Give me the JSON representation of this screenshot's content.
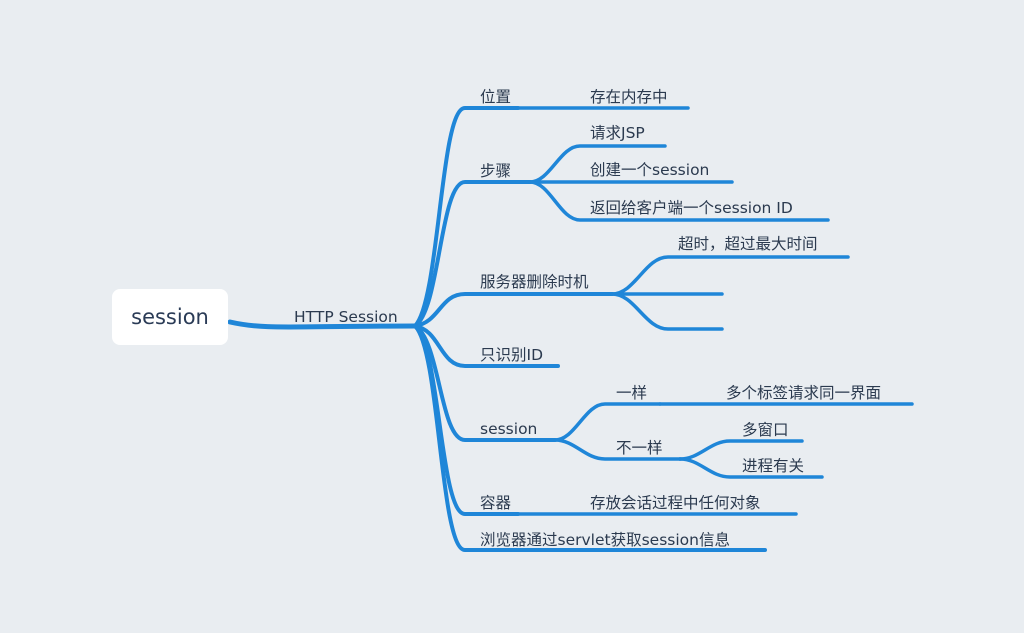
{
  "root": {
    "label": "session"
  },
  "main_branch": {
    "label": "HTTP Session"
  },
  "branches": [
    {
      "label": "位置",
      "children": [
        {
          "label": "存在内存中"
        }
      ]
    },
    {
      "label": "步骤",
      "children": [
        {
          "label": "请求JSP"
        },
        {
          "label": "创建一个session"
        },
        {
          "label": "返回给客户端一个session ID"
        }
      ]
    },
    {
      "label": "服务器删除时机",
      "children": [
        {
          "label": "超时，超过最大时间"
        },
        {
          "label": ""
        },
        {
          "label": ""
        }
      ]
    },
    {
      "label": "只识别ID",
      "children": []
    },
    {
      "label": "session",
      "children": [
        {
          "label": "一样",
          "children": [
            {
              "label": "多个标签请求同一界面"
            }
          ]
        },
        {
          "label": "不一样",
          "children": [
            {
              "label": "多窗口"
            },
            {
              "label": "进程有关"
            }
          ]
        }
      ]
    },
    {
      "label": "容器",
      "children": [
        {
          "label": "存放会话过程中任何对象"
        }
      ]
    },
    {
      "label": "浏览器通过servlet获取session信息",
      "children": []
    }
  ],
  "colors": {
    "background": "#e9edf1",
    "connector": "#1f86d8",
    "text": "#2b3a4f",
    "root_box": "#ffffff"
  }
}
